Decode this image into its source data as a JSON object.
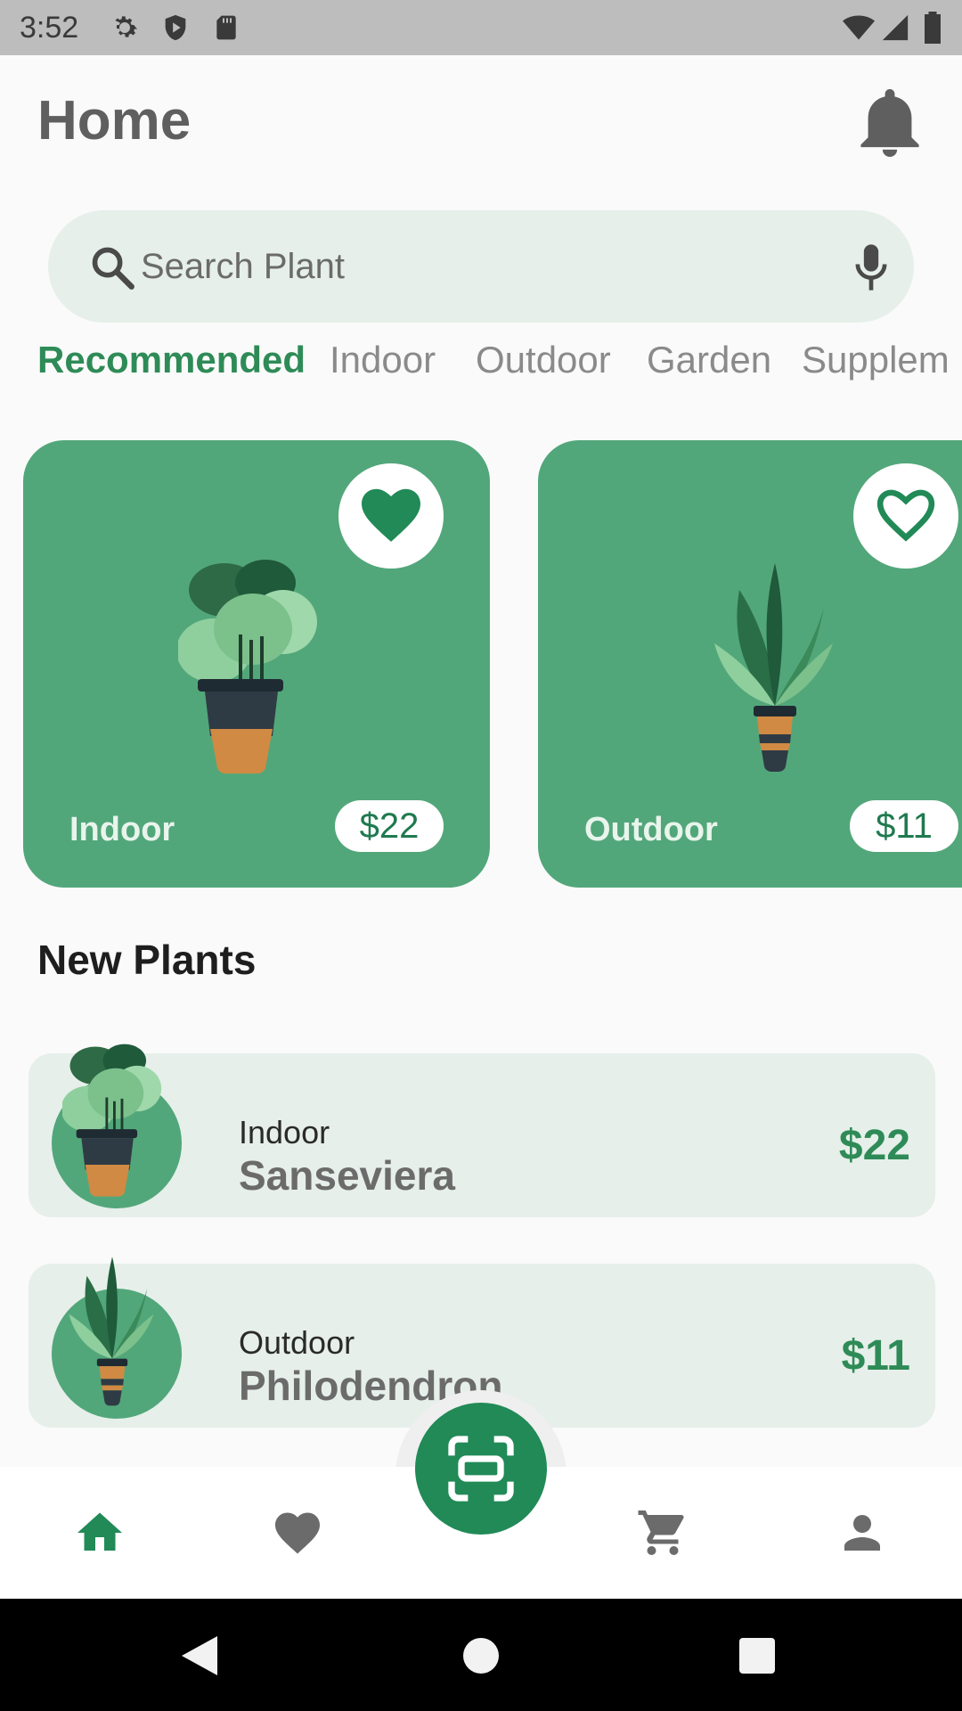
{
  "status_bar": {
    "time": "3:52",
    "left_icons": [
      "gear-icon",
      "shield-icon",
      "sd-card-icon"
    ],
    "right_icons": [
      "wifi-icon",
      "signal-icon",
      "battery-icon"
    ]
  },
  "header": {
    "title": "Home",
    "notification_icon": "bell-icon"
  },
  "search": {
    "placeholder": "Search Plant",
    "value": "",
    "left_icon": "search-icon",
    "right_icon": "microphone-icon"
  },
  "tabs": [
    {
      "label": "Recommended",
      "active": true
    },
    {
      "label": "Indoor",
      "active": false
    },
    {
      "label": "Outdoor",
      "active": false
    },
    {
      "label": "Garden",
      "active": false
    },
    {
      "label": "Supplem",
      "active": false
    }
  ],
  "featured": [
    {
      "category": "Indoor",
      "price": "$22",
      "favorited": true
    },
    {
      "category": "Outdoor",
      "price": "$11",
      "favorited": false
    }
  ],
  "new_plants": {
    "title": "New Plants",
    "items": [
      {
        "category": "Indoor",
        "name": "Sanseviera",
        "price": "$22"
      },
      {
        "category": "Outdoor",
        "name": "Philodendron",
        "price": "$11"
      }
    ]
  },
  "bottom_nav": {
    "items": [
      "home-icon",
      "heart-icon",
      "scan-icon",
      "cart-icon",
      "person-icon"
    ],
    "active": "home-icon"
  },
  "colors": {
    "accent": "#2e8b57",
    "card": "#52a77a",
    "search_bg": "#e6efea",
    "scan_button": "#218a57"
  }
}
